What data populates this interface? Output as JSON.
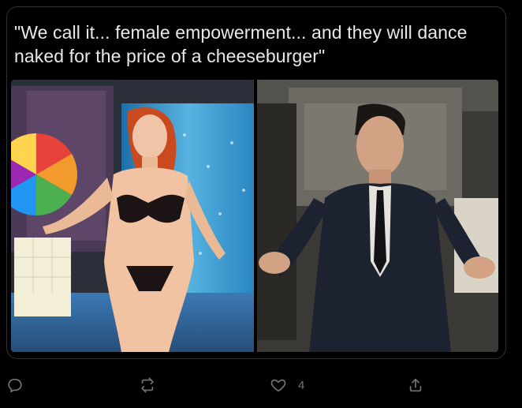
{
  "tweet": {
    "text": "\"We call it... female empowerment... and they will dance naked for the price of a cheeseburger\"",
    "media": {
      "left_panel": "streamer-webcam-image",
      "right_panel": "man-in-suit-shrug-image"
    }
  },
  "actions": {
    "reply": {
      "icon": "reply-icon",
      "count": ""
    },
    "retweet": {
      "icon": "retweet-icon",
      "count": ""
    },
    "like": {
      "icon": "heart-icon",
      "count": "4"
    },
    "share": {
      "icon": "share-icon",
      "count": ""
    }
  },
  "colors": {
    "background": "#000000",
    "text": "#e7e9ea",
    "muted": "#71767b",
    "border": "#2f3336"
  }
}
